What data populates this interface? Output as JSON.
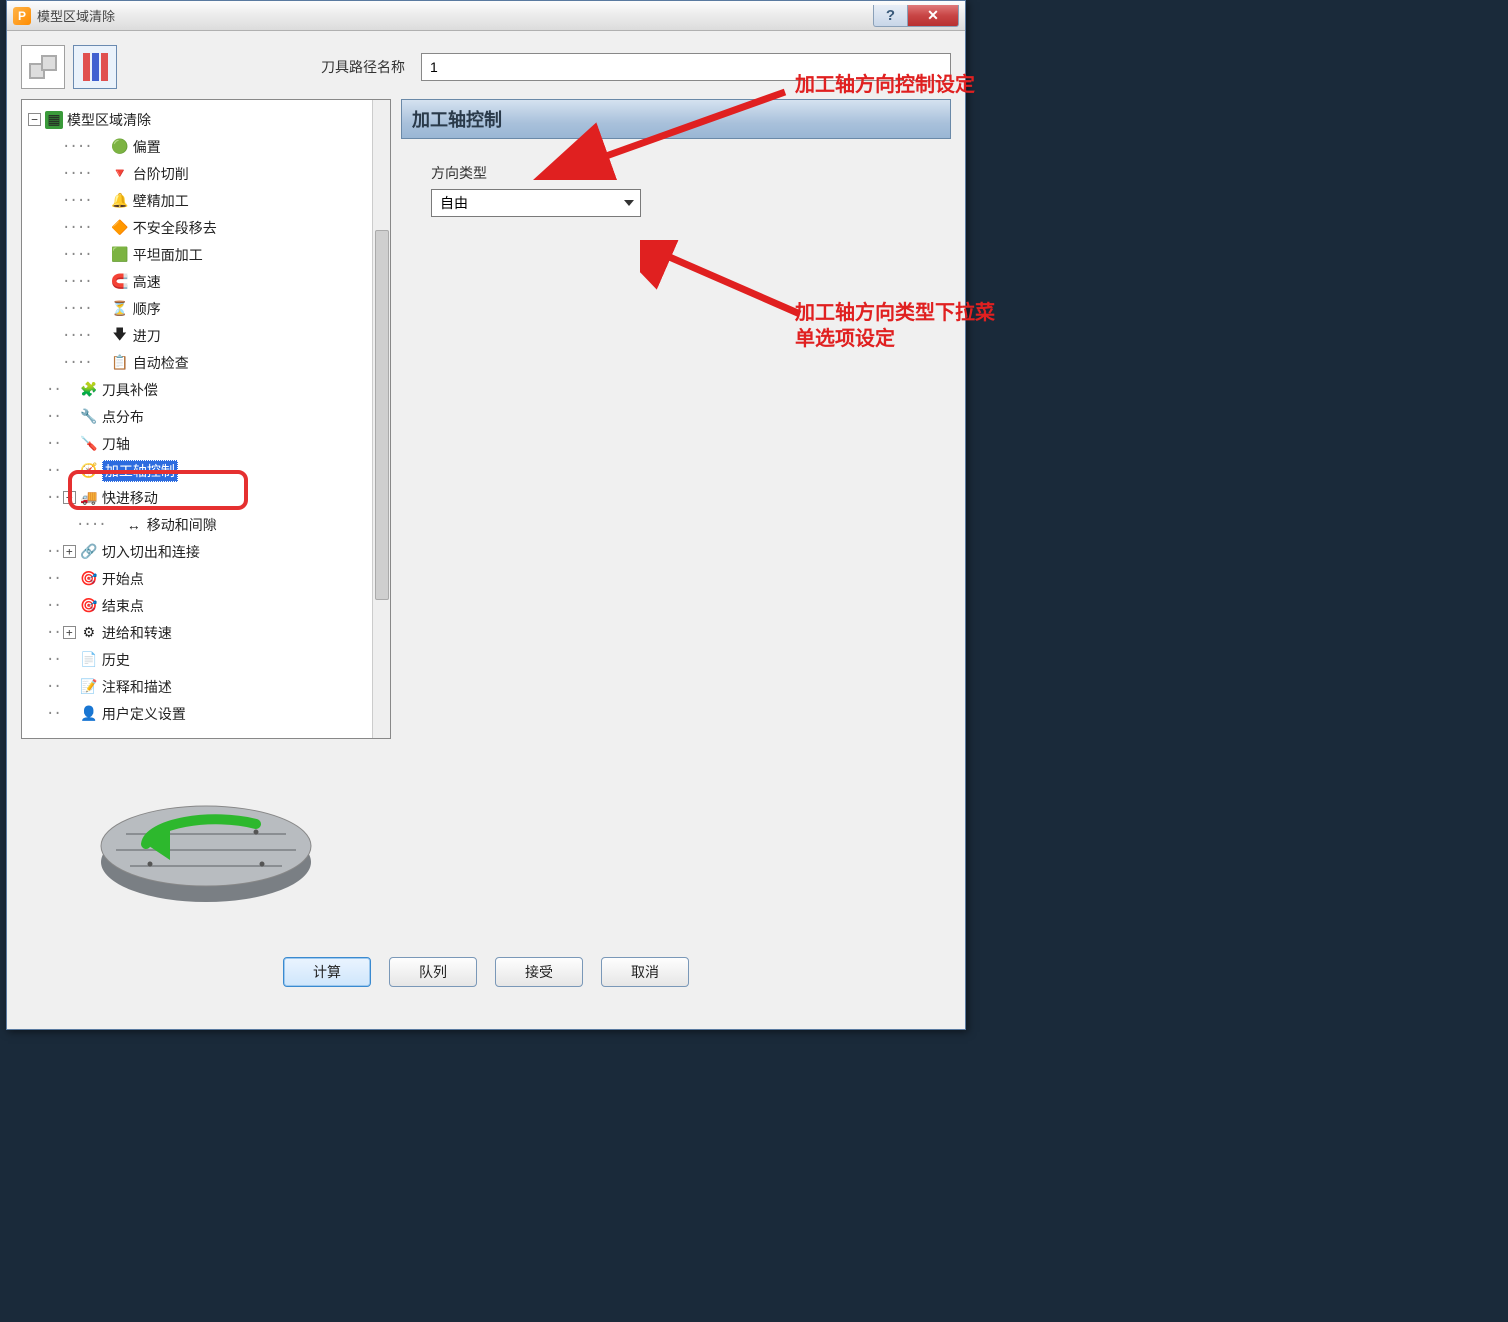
{
  "window": {
    "title": "模型区域清除",
    "app_icon_letter": "P"
  },
  "toolbar": {
    "path_name_label": "刀具路径名称",
    "path_name_value": "1"
  },
  "tree": {
    "root": "模型区域清除",
    "items_l2": [
      "偏置",
      "台阶切削",
      "壁精加工",
      "不安全段移去",
      "平坦面加工",
      "高速",
      "顺序",
      "进刀",
      "自动检查"
    ],
    "items_l1": [
      "刀具补偿",
      "点分布",
      "刀轴",
      "加工轴控制",
      "快进移动",
      "移动和间隙",
      "切入切出和连接",
      "开始点",
      "结束点",
      "进给和转速",
      "历史",
      "注释和描述",
      "用户定义设置"
    ],
    "selected": "加工轴控制"
  },
  "panel": {
    "section_title": "加工轴控制",
    "direction_type_label": "方向类型",
    "direction_type_value": "自由"
  },
  "buttons": {
    "calc": "计算",
    "queue": "队列",
    "accept": "接受",
    "cancel": "取消"
  },
  "annotations": {
    "a1": "加工轴方向控制设定",
    "a2": "加工轴方向类型下拉菜单选项设定"
  },
  "icons": {
    "l2": [
      "🟢",
      "🔻",
      "🔔",
      "🔶",
      "🟩",
      "🧲",
      "⏳",
      "🡇",
      "📋"
    ],
    "l1": [
      "🧩",
      "🔧",
      "🪛",
      "🧭",
      "🚚",
      "↔",
      "🔗",
      "🎯",
      "🎯",
      "⚙",
      "📄",
      "📝",
      "👤"
    ]
  }
}
